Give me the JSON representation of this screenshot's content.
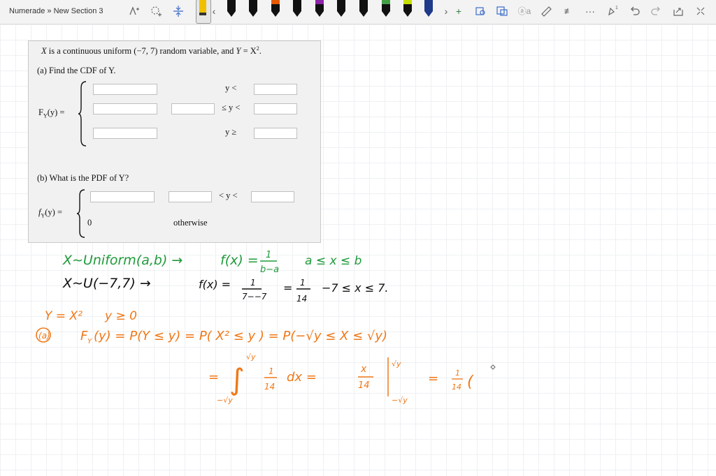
{
  "breadcrumb": "Numerade » New Section 3",
  "toolbar": {
    "icons": [
      "lasso-select-icon",
      "add-space-icon",
      "insert-space-icon",
      "overflow-left-icon",
      "overflow-right-icon",
      "add-pen-icon",
      "ink-to-shape-icon",
      "ink-to-text-icon",
      "ink-to-math-icon",
      "ruler-icon",
      "math-icon",
      "more-icon",
      "replay-icon",
      "undo-icon",
      "redo-icon",
      "share-icon",
      "fullscreen-icon"
    ],
    "pen_colors": [
      "#1a1a1a",
      "#f0c000",
      "#111111",
      "#111111",
      "#111111",
      "#e65a00",
      "#111111",
      "#111111",
      "#8e24aa",
      "#111111",
      "#111111",
      "#43a047",
      "#c6e000",
      "#111111",
      "#1e3a8a"
    ]
  },
  "problem": {
    "statement_x": "X",
    "statement_mid": " is a continuous uniform (−7, 7) random variable, and ",
    "statement_y": "Y",
    "statement_eq": " = X",
    "statement_sup": "2",
    "statement_end": ".",
    "part_a": "(a)   Find the CDF of Y.",
    "cdf_label": "F",
    "cdf_sub": "Y",
    "cdf_arg": "(y) =",
    "row1_rel": "y <",
    "row2_rel": "≤ y <",
    "row3_rel": "y ≥",
    "part_b": "(b)   What is the PDF of Y?",
    "pdf_label": "f",
    "pdf_sub": "Y",
    "pdf_arg": "(y) =",
    "pdf_rel": "< y <",
    "pdf_zero": "0",
    "pdf_otherwise": "otherwise"
  },
  "handwriting": {
    "line1": [
      "X∼Uniform(a,b) →",
      "f(x) =",
      "1",
      "b−a",
      "a ≤ x ≤ b"
    ],
    "line2": [
      "X∼U(−7,7) →",
      "f(x) =",
      "1",
      "7−−7",
      "=",
      "1",
      "14",
      "−7 ≤ x ≤ 7."
    ],
    "line3": [
      "Y = X²",
      "y ≥ 0"
    ],
    "line4": [
      "(a)",
      "F",
      "Y",
      "(y) = P(Y ≤ y) = P( X² ≤ y ) = P(−√y ≤ X ≤ √y)"
    ],
    "line5": [
      "=",
      "∫",
      "√y",
      "−√y",
      "1",
      "14",
      "dx =",
      "x",
      "14",
      "√y",
      "−√y",
      "=",
      "1",
      "14",
      "("
    ]
  },
  "colors": {
    "green_ink": "#1f9a3a",
    "black_ink": "#111111",
    "orange_ink": "#f07818"
  }
}
